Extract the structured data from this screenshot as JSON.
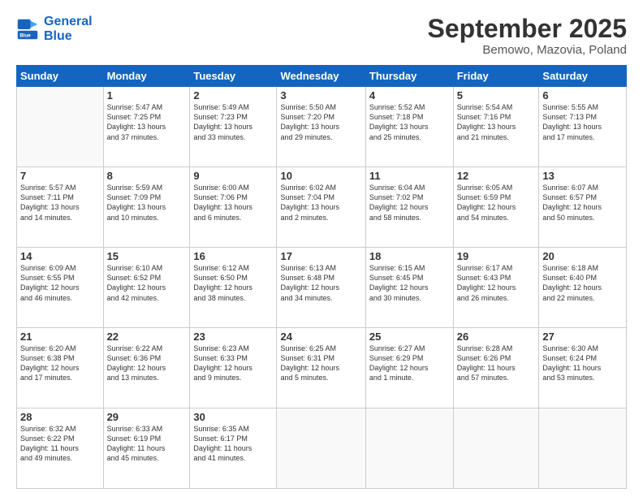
{
  "header": {
    "logo_line1": "General",
    "logo_line2": "Blue",
    "title": "September 2025",
    "subtitle": "Bemowo, Mazovia, Poland"
  },
  "weekdays": [
    "Sunday",
    "Monday",
    "Tuesday",
    "Wednesday",
    "Thursday",
    "Friday",
    "Saturday"
  ],
  "weeks": [
    [
      {
        "day": "",
        "text": ""
      },
      {
        "day": "1",
        "text": "Sunrise: 5:47 AM\nSunset: 7:25 PM\nDaylight: 13 hours\nand 37 minutes."
      },
      {
        "day": "2",
        "text": "Sunrise: 5:49 AM\nSunset: 7:23 PM\nDaylight: 13 hours\nand 33 minutes."
      },
      {
        "day": "3",
        "text": "Sunrise: 5:50 AM\nSunset: 7:20 PM\nDaylight: 13 hours\nand 29 minutes."
      },
      {
        "day": "4",
        "text": "Sunrise: 5:52 AM\nSunset: 7:18 PM\nDaylight: 13 hours\nand 25 minutes."
      },
      {
        "day": "5",
        "text": "Sunrise: 5:54 AM\nSunset: 7:16 PM\nDaylight: 13 hours\nand 21 minutes."
      },
      {
        "day": "6",
        "text": "Sunrise: 5:55 AM\nSunset: 7:13 PM\nDaylight: 13 hours\nand 17 minutes."
      }
    ],
    [
      {
        "day": "7",
        "text": "Sunrise: 5:57 AM\nSunset: 7:11 PM\nDaylight: 13 hours\nand 14 minutes."
      },
      {
        "day": "8",
        "text": "Sunrise: 5:59 AM\nSunset: 7:09 PM\nDaylight: 13 hours\nand 10 minutes."
      },
      {
        "day": "9",
        "text": "Sunrise: 6:00 AM\nSunset: 7:06 PM\nDaylight: 13 hours\nand 6 minutes."
      },
      {
        "day": "10",
        "text": "Sunrise: 6:02 AM\nSunset: 7:04 PM\nDaylight: 13 hours\nand 2 minutes."
      },
      {
        "day": "11",
        "text": "Sunrise: 6:04 AM\nSunset: 7:02 PM\nDaylight: 12 hours\nand 58 minutes."
      },
      {
        "day": "12",
        "text": "Sunrise: 6:05 AM\nSunset: 6:59 PM\nDaylight: 12 hours\nand 54 minutes."
      },
      {
        "day": "13",
        "text": "Sunrise: 6:07 AM\nSunset: 6:57 PM\nDaylight: 12 hours\nand 50 minutes."
      }
    ],
    [
      {
        "day": "14",
        "text": "Sunrise: 6:09 AM\nSunset: 6:55 PM\nDaylight: 12 hours\nand 46 minutes."
      },
      {
        "day": "15",
        "text": "Sunrise: 6:10 AM\nSunset: 6:52 PM\nDaylight: 12 hours\nand 42 minutes."
      },
      {
        "day": "16",
        "text": "Sunrise: 6:12 AM\nSunset: 6:50 PM\nDaylight: 12 hours\nand 38 minutes."
      },
      {
        "day": "17",
        "text": "Sunrise: 6:13 AM\nSunset: 6:48 PM\nDaylight: 12 hours\nand 34 minutes."
      },
      {
        "day": "18",
        "text": "Sunrise: 6:15 AM\nSunset: 6:45 PM\nDaylight: 12 hours\nand 30 minutes."
      },
      {
        "day": "19",
        "text": "Sunrise: 6:17 AM\nSunset: 6:43 PM\nDaylight: 12 hours\nand 26 minutes."
      },
      {
        "day": "20",
        "text": "Sunrise: 6:18 AM\nSunset: 6:40 PM\nDaylight: 12 hours\nand 22 minutes."
      }
    ],
    [
      {
        "day": "21",
        "text": "Sunrise: 6:20 AM\nSunset: 6:38 PM\nDaylight: 12 hours\nand 17 minutes."
      },
      {
        "day": "22",
        "text": "Sunrise: 6:22 AM\nSunset: 6:36 PM\nDaylight: 12 hours\nand 13 minutes."
      },
      {
        "day": "23",
        "text": "Sunrise: 6:23 AM\nSunset: 6:33 PM\nDaylight: 12 hours\nand 9 minutes."
      },
      {
        "day": "24",
        "text": "Sunrise: 6:25 AM\nSunset: 6:31 PM\nDaylight: 12 hours\nand 5 minutes."
      },
      {
        "day": "25",
        "text": "Sunrise: 6:27 AM\nSunset: 6:29 PM\nDaylight: 12 hours\nand 1 minute."
      },
      {
        "day": "26",
        "text": "Sunrise: 6:28 AM\nSunset: 6:26 PM\nDaylight: 11 hours\nand 57 minutes."
      },
      {
        "day": "27",
        "text": "Sunrise: 6:30 AM\nSunset: 6:24 PM\nDaylight: 11 hours\nand 53 minutes."
      }
    ],
    [
      {
        "day": "28",
        "text": "Sunrise: 6:32 AM\nSunset: 6:22 PM\nDaylight: 11 hours\nand 49 minutes."
      },
      {
        "day": "29",
        "text": "Sunrise: 6:33 AM\nSunset: 6:19 PM\nDaylight: 11 hours\nand 45 minutes."
      },
      {
        "day": "30",
        "text": "Sunrise: 6:35 AM\nSunset: 6:17 PM\nDaylight: 11 hours\nand 41 minutes."
      },
      {
        "day": "",
        "text": ""
      },
      {
        "day": "",
        "text": ""
      },
      {
        "day": "",
        "text": ""
      },
      {
        "day": "",
        "text": ""
      }
    ]
  ]
}
